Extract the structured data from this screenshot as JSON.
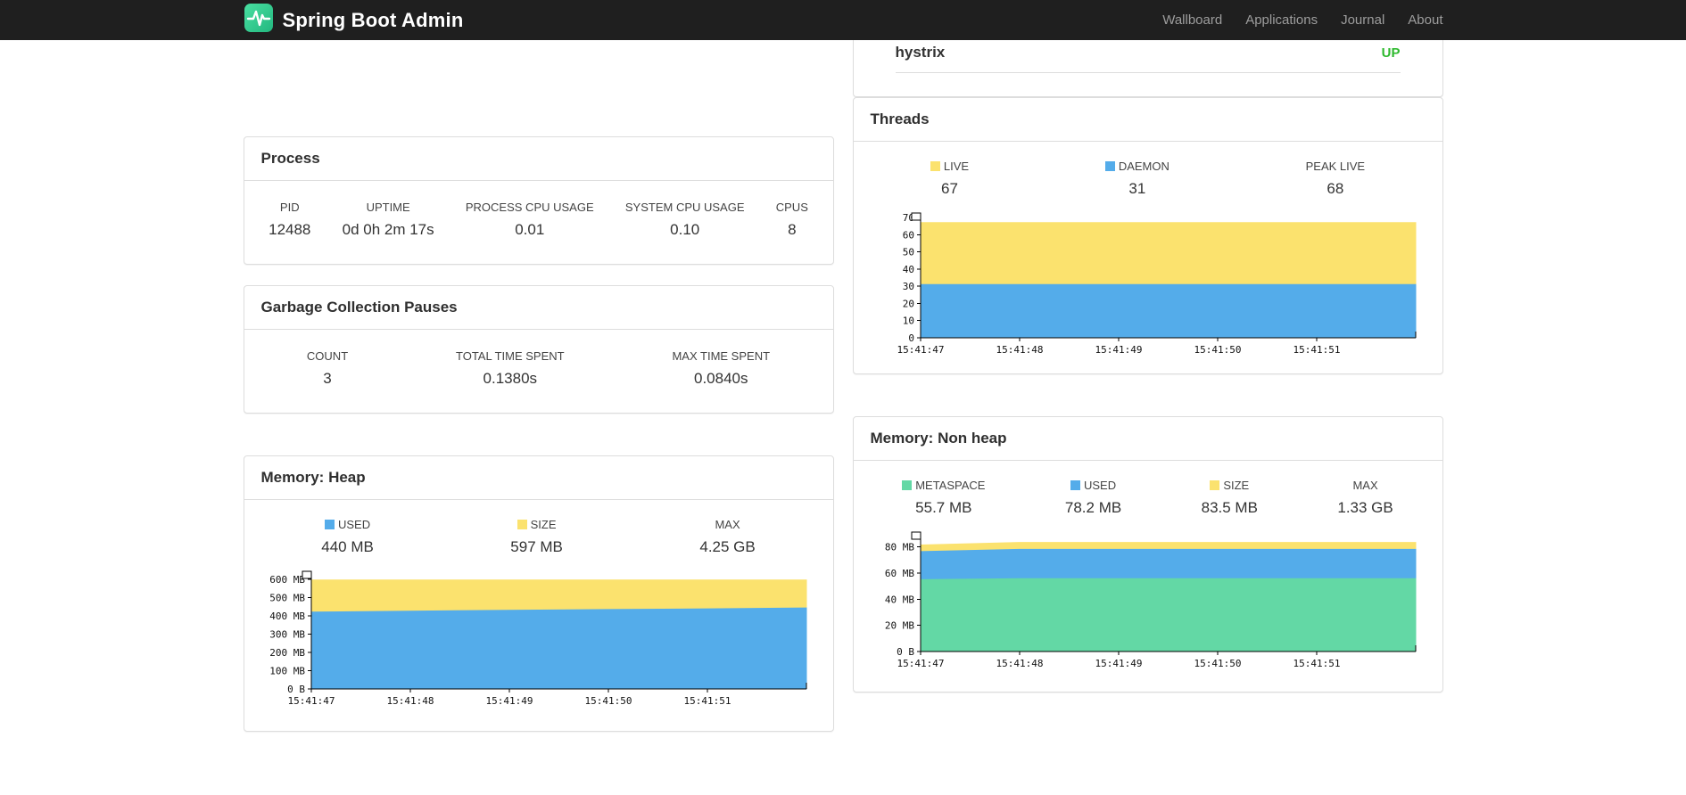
{
  "navbar": {
    "brand": "Spring Boot Admin",
    "items": [
      {
        "label": "Wallboard"
      },
      {
        "label": "Applications"
      },
      {
        "label": "Journal"
      },
      {
        "label": "About"
      }
    ]
  },
  "colors": {
    "navbar_bg": "#1f1f1f",
    "brand_green": "#36d096",
    "series_blue": "#54acea",
    "series_yellow": "#fbe26e",
    "series_green": "#63d8a5",
    "status_up": "#2db92d",
    "card_border": "#dddddd"
  },
  "status_card": {
    "service": "hystrix",
    "status": "UP"
  },
  "process_card": {
    "title": "Process",
    "stats": [
      {
        "label": "PID",
        "value": "12488"
      },
      {
        "label": "UPTIME",
        "value": "0d 0h 2m 17s"
      },
      {
        "label": "PROCESS CPU USAGE",
        "value": "0.01"
      },
      {
        "label": "SYSTEM CPU USAGE",
        "value": "0.10"
      },
      {
        "label": "CPUS",
        "value": "8"
      }
    ]
  },
  "gc_card": {
    "title": "Garbage Collection Pauses",
    "stats": [
      {
        "label": "COUNT",
        "value": "3"
      },
      {
        "label": "TOTAL TIME SPENT",
        "value": "0.1380s"
      },
      {
        "label": "MAX TIME SPENT",
        "value": "0.0840s"
      }
    ]
  },
  "threads_card": {
    "title": "Threads",
    "legend": [
      {
        "label": "LIVE",
        "value": "67",
        "color": "#fbe26e"
      },
      {
        "label": "DAEMON",
        "value": "31",
        "color": "#54acea"
      },
      {
        "label": "PEAK LIVE",
        "value": "68",
        "color": null
      }
    ]
  },
  "heap_card": {
    "title": "Memory: Heap",
    "legend": [
      {
        "label": "USED",
        "value": "440 MB",
        "color": "#54acea"
      },
      {
        "label": "SIZE",
        "value": "597 MB",
        "color": "#fbe26e"
      },
      {
        "label": "MAX",
        "value": "4.25 GB",
        "color": null
      }
    ]
  },
  "nonheap_card": {
    "title": "Memory: Non heap",
    "legend": [
      {
        "label": "METASPACE",
        "value": "55.7 MB",
        "color": "#63d8a5"
      },
      {
        "label": "USED",
        "value": "78.2 MB",
        "color": "#54acea"
      },
      {
        "label": "SIZE",
        "value": "83.5 MB",
        "color": "#fbe26e"
      },
      {
        "label": "MAX",
        "value": "1.33 GB",
        "color": null
      }
    ]
  },
  "chart_data": [
    {
      "id": "threads-chart",
      "type": "area",
      "stacked": true,
      "ymax": 70,
      "x_tick_labels": [
        "15:41:47",
        "15:41:48",
        "15:41:49",
        "15:41:50",
        "15:41:51"
      ],
      "y_ticks": [
        {
          "v": 0,
          "label": "0"
        },
        {
          "v": 10,
          "label": "10"
        },
        {
          "v": 20,
          "label": "20"
        },
        {
          "v": 30,
          "label": "30"
        },
        {
          "v": 40,
          "label": "40"
        },
        {
          "v": 50,
          "label": "50"
        },
        {
          "v": 60,
          "label": "60"
        },
        {
          "v": 70,
          "label": "70"
        }
      ],
      "series": [
        {
          "name": "LIVE",
          "color": "#fbe26e",
          "values": [
            67,
            67,
            67,
            67,
            67,
            67
          ]
        },
        {
          "name": "DAEMON",
          "color": "#54acea",
          "values": [
            31,
            31,
            31,
            31,
            31,
            31
          ]
        }
      ]
    },
    {
      "id": "heap-chart",
      "type": "area",
      "stacked": true,
      "ymax": 620,
      "x_tick_labels": [
        "15:41:47",
        "15:41:48",
        "15:41:49",
        "15:41:50",
        "15:41:51"
      ],
      "y_ticks": [
        {
          "v": 0,
          "label": "0 B"
        },
        {
          "v": 100,
          "label": "100 MB"
        },
        {
          "v": 200,
          "label": "200 MB"
        },
        {
          "v": 300,
          "label": "300 MB"
        },
        {
          "v": 400,
          "label": "400 MB"
        },
        {
          "v": 500,
          "label": "500 MB"
        },
        {
          "v": 600,
          "label": "600 MB"
        }
      ],
      "series": [
        {
          "name": "SIZE",
          "color": "#fbe26e",
          "values": [
            597,
            597,
            597,
            597,
            597,
            597
          ]
        },
        {
          "name": "USED",
          "color": "#54acea",
          "values": [
            421,
            426,
            431,
            435,
            439,
            444
          ]
        }
      ]
    },
    {
      "id": "nonheap-chart",
      "type": "area",
      "stacked": true,
      "ymax": 88,
      "x_tick_labels": [
        "15:41:47",
        "15:41:48",
        "15:41:49",
        "15:41:50",
        "15:41:51"
      ],
      "y_ticks": [
        {
          "v": 0,
          "label": "0 B"
        },
        {
          "v": 20,
          "label": "20 MB"
        },
        {
          "v": 40,
          "label": "40 MB"
        },
        {
          "v": 60,
          "label": "60 MB"
        },
        {
          "v": 80,
          "label": "80 MB"
        }
      ],
      "series": [
        {
          "name": "SIZE",
          "color": "#fbe26e",
          "values": [
            81.5,
            83.5,
            83.5,
            83.5,
            83.5,
            83.5
          ]
        },
        {
          "name": "USED",
          "color": "#54acea",
          "values": [
            76.5,
            78.2,
            78.2,
            78.2,
            78.2,
            78.2
          ]
        },
        {
          "name": "METASPACE",
          "color": "#63d8a5",
          "values": [
            55.0,
            55.7,
            55.7,
            55.7,
            55.7,
            55.7
          ]
        }
      ]
    }
  ]
}
